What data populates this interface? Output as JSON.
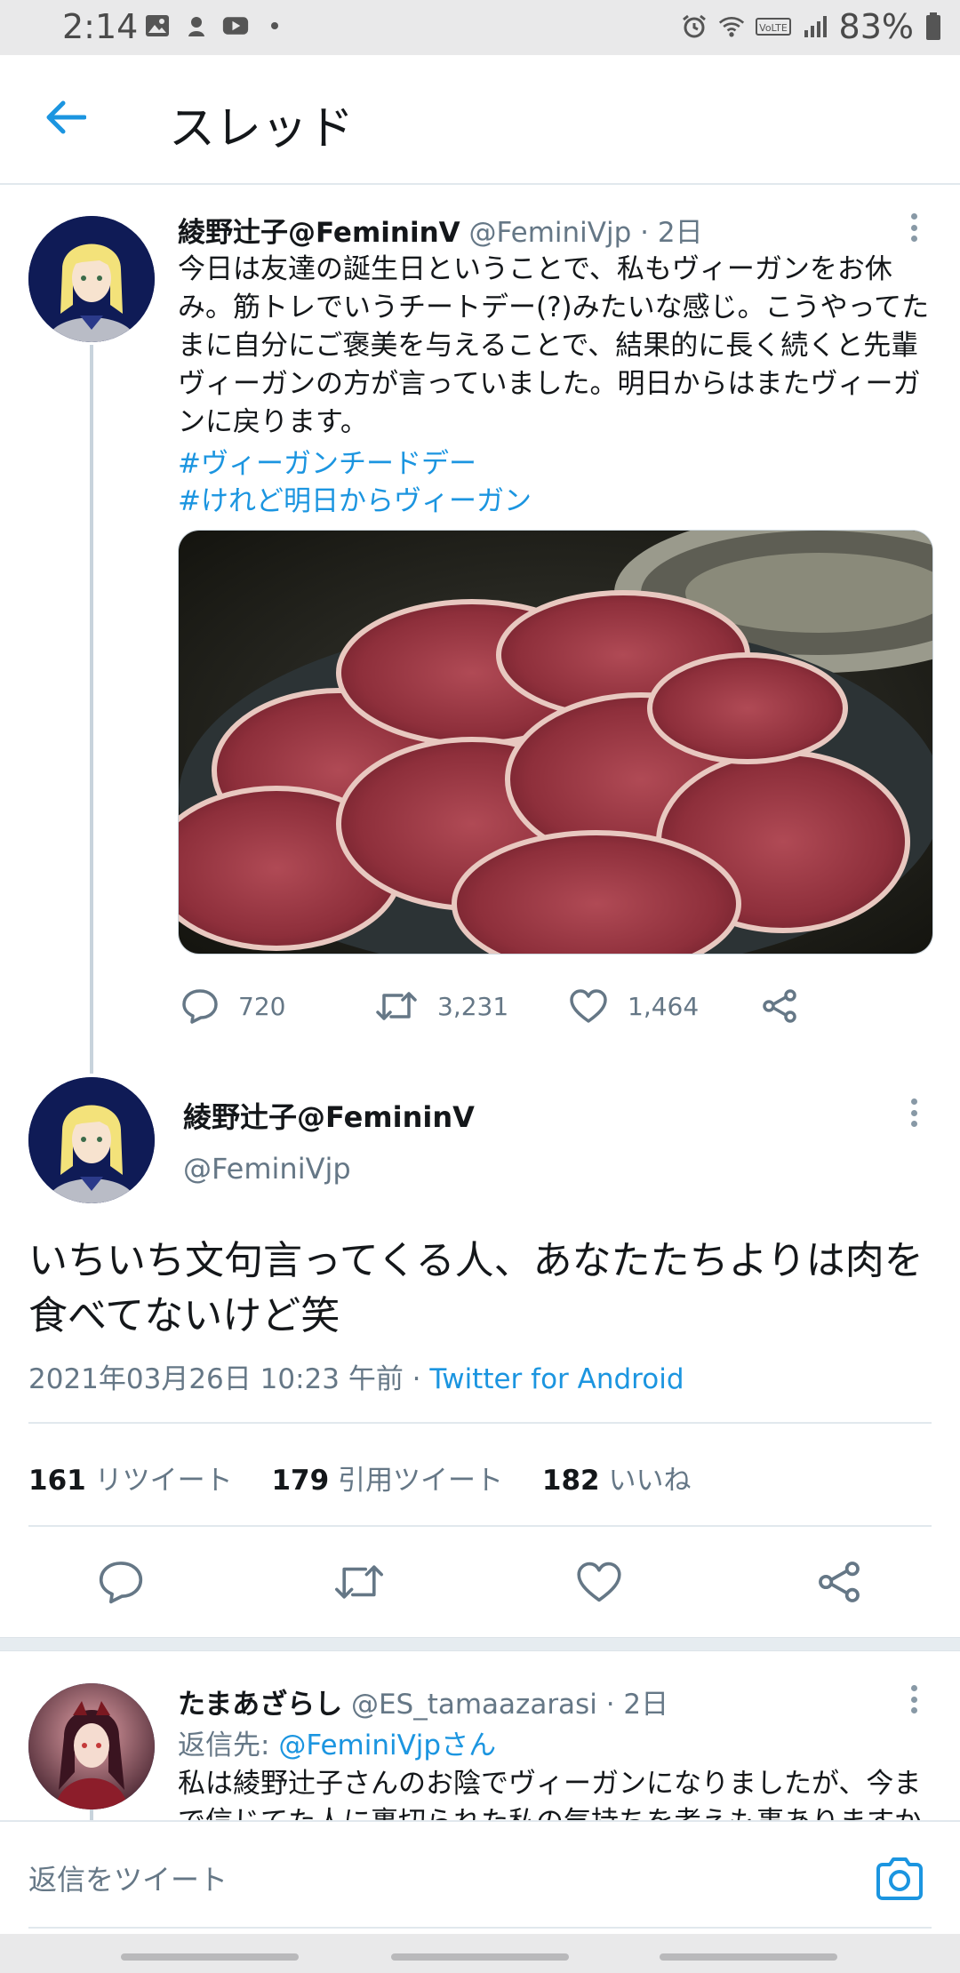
{
  "status_bar": {
    "time": "2:14",
    "battery": "83%",
    "left_icons": [
      "image-icon",
      "headset-icon",
      "youtube-icon",
      "dot-icon"
    ],
    "right_icons": [
      "alarm-icon",
      "wifi-icon",
      "volte-icon",
      "signal-icon",
      "battery-icon"
    ]
  },
  "header": {
    "back_icon": "back-arrow-icon",
    "title": "スレッド"
  },
  "tweet1": {
    "display_name": "綾野辻子@FemininV",
    "handle": "@FeminiVjp",
    "time": "· 2日",
    "text": "今日は友達の誕生日ということで、私もヴィーガンをお休み。筋トレでいうチートデー(?)みたいな感じ。こうやってたまに自分にご褒美を与えることで、結果的に長く続くと先輩ヴィーガンの方が言っていました。明日からはまたヴィーガンに戻ります。",
    "hashtag1": "#ヴィーガンチードデー",
    "hashtag2": "#けれど明日からヴィーガン",
    "media_description": "photo-meat-slices",
    "replies": "720",
    "retweets": "3,231",
    "likes": "1,464"
  },
  "tweet2": {
    "display_name": "綾野辻子@FemininV",
    "handle": "@FeminiVjp",
    "text": "いちいち文句言ってくる人、あなたたちよりは肉を食べてないけど笑",
    "timestamp": "2021年03月26日 10:23 午前 · ",
    "client": "Twitter for Android",
    "retweet_count": "161",
    "retweet_label": "リツイート",
    "quote_count": "179",
    "quote_label": "引用ツイート",
    "like_count": "182",
    "like_label": "いいね"
  },
  "tweet3": {
    "display_name": "たまあざらし",
    "handle": "@ES_tamaazarasi",
    "time": "· 2日",
    "reply_to_label": "返信先: ",
    "reply_to_mention": "@FeminiVjpさん",
    "text": "私は綾野辻子さんのお陰でヴィーガンになりましたが、今まで信じてた人に裏切られた私の気持ちを考えも事ありますか"
  },
  "composer": {
    "placeholder": "返信をツイート",
    "camera_icon": "camera-icon"
  },
  "colors": {
    "accent": "#1b95e0",
    "text_primary": "#14171a",
    "text_secondary": "#657786",
    "divider": "#e1e8ed"
  }
}
